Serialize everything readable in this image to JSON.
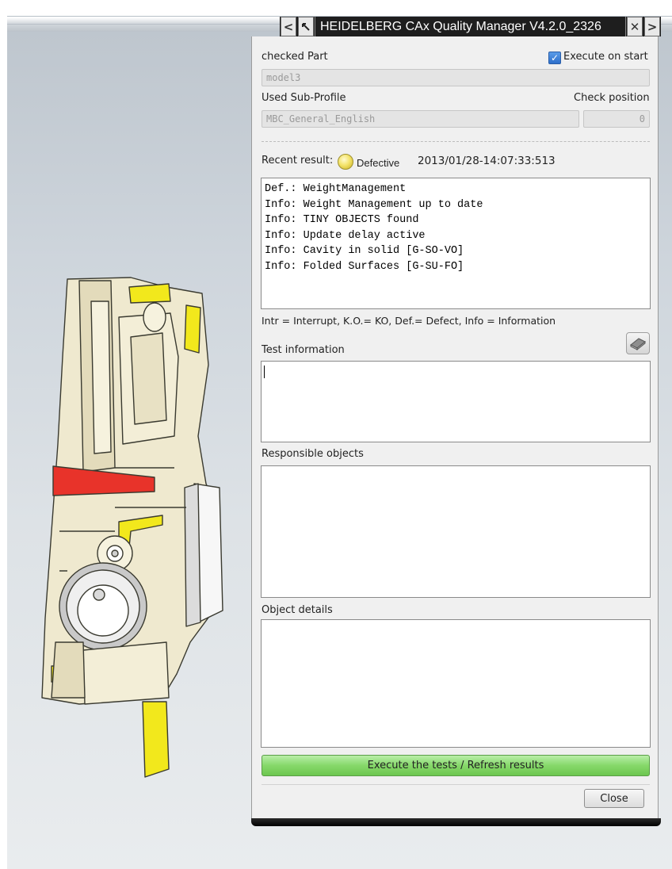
{
  "window": {
    "title": "HEIDELBERG CAx Quality Manager V4.2.0_2326",
    "nav_prev_glyph": "<",
    "nav_next_glyph": ">",
    "close_glyph": "✕"
  },
  "checked_part": {
    "label": "checked Part",
    "value": "model3"
  },
  "execute_on_start": {
    "label": "Execute on start",
    "checked": true
  },
  "sub_profile": {
    "label": "Used Sub-Profile",
    "value": "MBC_General_English"
  },
  "check_position": {
    "label": "Check position",
    "value": "0"
  },
  "recent_result": {
    "label": "Recent result:",
    "status": "Defective",
    "status_color": "#f4e46c",
    "timestamp": "2013/01/28-14:07:33:513"
  },
  "results": [
    "Def.: WeightManagement",
    "Info: Weight Management up to date",
    "Info: TINY OBJECTS found",
    "Info: Update delay active",
    "Info: Cavity in solid [G-SO-VO]",
    "Info: Folded Surfaces [G-SU-FO]"
  ],
  "legend": "Intr = Interrupt, K.O.= KO, Def.= Defect, Info = Information",
  "test_information": {
    "label": "Test information",
    "value": ""
  },
  "responsible_objects": {
    "label": "Responsible objects"
  },
  "object_details": {
    "label": "Object details"
  },
  "buttons": {
    "execute": "Execute the tests / Refresh results",
    "close": "Close"
  },
  "colors": {
    "execute_button": "#86d86a",
    "model_yellow": "#f2e81c",
    "model_red": "#e8332a",
    "model_body": "#efe9cf"
  }
}
